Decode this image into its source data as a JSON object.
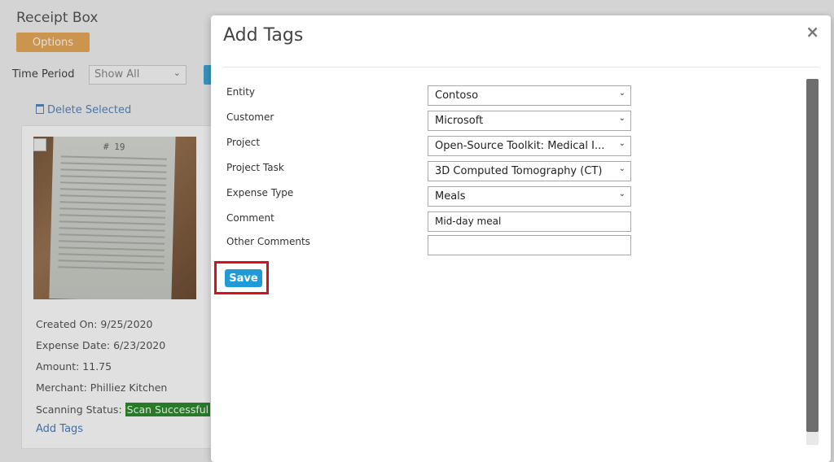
{
  "background_app": {
    "title": "Receipt Box",
    "options_label": "Options",
    "time_period_label": "Time Period",
    "time_period_value": "Show All",
    "delete_selected_label": "Delete Selected",
    "receipt": {
      "image_number": "# 19",
      "created_on": "Created On: 9/25/2020",
      "expense_date": "Expense Date: 6/23/2020",
      "amount": "Amount: 11.75",
      "merchant": "Merchant: Philliez Kitchen",
      "scanning_status_label": "Scanning Status:",
      "scanning_status_value": "Scan Successful",
      "add_tags_link": "Add Tags"
    }
  },
  "modal": {
    "title": "Add Tags",
    "close_symbol": "×",
    "fields": {
      "entity": {
        "label": "Entity",
        "value": "Contoso"
      },
      "customer": {
        "label": "Customer",
        "value": "Microsoft"
      },
      "project": {
        "label": "Project",
        "value": "Open-Source Toolkit: Medical I..."
      },
      "project_task": {
        "label": "Project Task",
        "value": "3D Computed Tomography (CT)"
      },
      "expense_type": {
        "label": "Expense Type",
        "value": "Meals"
      },
      "comment": {
        "label": "Comment",
        "value": "Mid-day meal"
      },
      "other_comments": {
        "label": "Other Comments",
        "value": ""
      }
    },
    "save_label": "Save"
  },
  "colors": {
    "save_button": "#1f9bd7",
    "highlight": "#d8101b",
    "status_success": "#2e8b2e",
    "options_button": "#e8a95a"
  }
}
